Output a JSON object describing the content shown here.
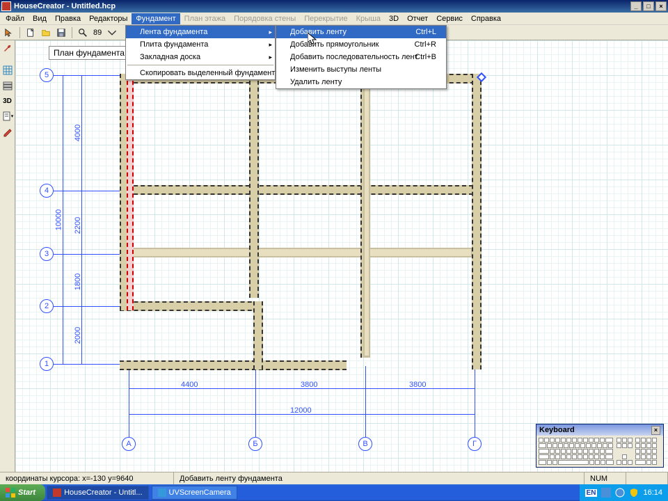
{
  "title": "HouseCreator - Untitled.hcp",
  "win_buttons": {
    "min": "_",
    "max": "□",
    "close": "×"
  },
  "menubar": {
    "file": "Файл",
    "view": "Вид",
    "edit": "Правка",
    "editors": "Редакторы",
    "foundation": "Фундамент",
    "floor": "План этажа",
    "walls": "Порядовка стены",
    "overlap": "Перекрытие",
    "roof": "Крыша",
    "td": "3D",
    "report": "Отчет",
    "service": "Сервис",
    "help": "Справка"
  },
  "toolbar": {
    "scale": "89"
  },
  "plan_label": "План фундамента:",
  "axes_v": {
    "1": "1",
    "2": "2",
    "3": "3",
    "4": "4",
    "5": "5"
  },
  "axes_h": {
    "a": "А",
    "b": "Б",
    "v": "В",
    "g": "Г"
  },
  "dims_v": {
    "d1": "2000",
    "d2": "1800",
    "d3": "2200",
    "d4": "4000",
    "total": "10000"
  },
  "dims_h": {
    "d1": "4400",
    "d2": "3800",
    "d3": "3800",
    "total": "12000"
  },
  "submenu1": {
    "strip": "Лента фундамента",
    "plate": "Плита фундамента",
    "board": "Закладная доска",
    "copy": "Скопировать выделенный фундамент"
  },
  "submenu2": {
    "add_strip": "Добавить ленту",
    "sc1": "Ctrl+L",
    "add_rect": "Добавить прямоугольник",
    "sc2": "Ctrl+R",
    "add_seq": "Добавить последовательность лент",
    "sc3": "Ctrl+B",
    "change": "Изменить выступы ленты",
    "delete": "Удалить ленту"
  },
  "status": {
    "coords": "координаты курсора: x=-130 y=9640",
    "hint": "Добавить ленту фундамента",
    "num": "NUM"
  },
  "taskbar": {
    "start": "Start",
    "app1": "HouseCreator - Untitl...",
    "app2": "UVScreenCamera",
    "lang": "EN",
    "time": "16:14"
  },
  "keyboard": {
    "title": "Keyboard",
    "close": "×"
  }
}
